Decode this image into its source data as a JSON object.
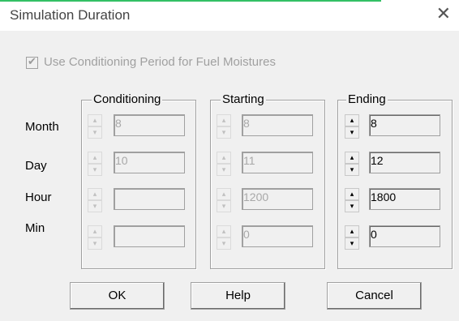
{
  "window": {
    "title": "Simulation Duration",
    "close_glyph": "✕"
  },
  "conditioning_checkbox": {
    "label": "Use Conditioning Period for Fuel Moistures",
    "checked": true,
    "check_glyph": "✔"
  },
  "rows": {
    "month": "Month",
    "day": "Day",
    "hour": "Hour",
    "min": "Min"
  },
  "groups": {
    "conditioning": {
      "title": "Conditioning",
      "month": "8",
      "day": "10",
      "hour": "",
      "min": ""
    },
    "starting": {
      "title": "Starting",
      "month": "8",
      "day": "11",
      "hour": "1200",
      "min": "0"
    },
    "ending": {
      "title": "Ending",
      "month": "8",
      "day": "12",
      "hour": "1800",
      "min": "0"
    }
  },
  "spinner_glyphs": {
    "up": "▴",
    "down": "▾"
  },
  "buttons": {
    "ok": "OK",
    "help": "Help",
    "cancel": "Cancel"
  }
}
